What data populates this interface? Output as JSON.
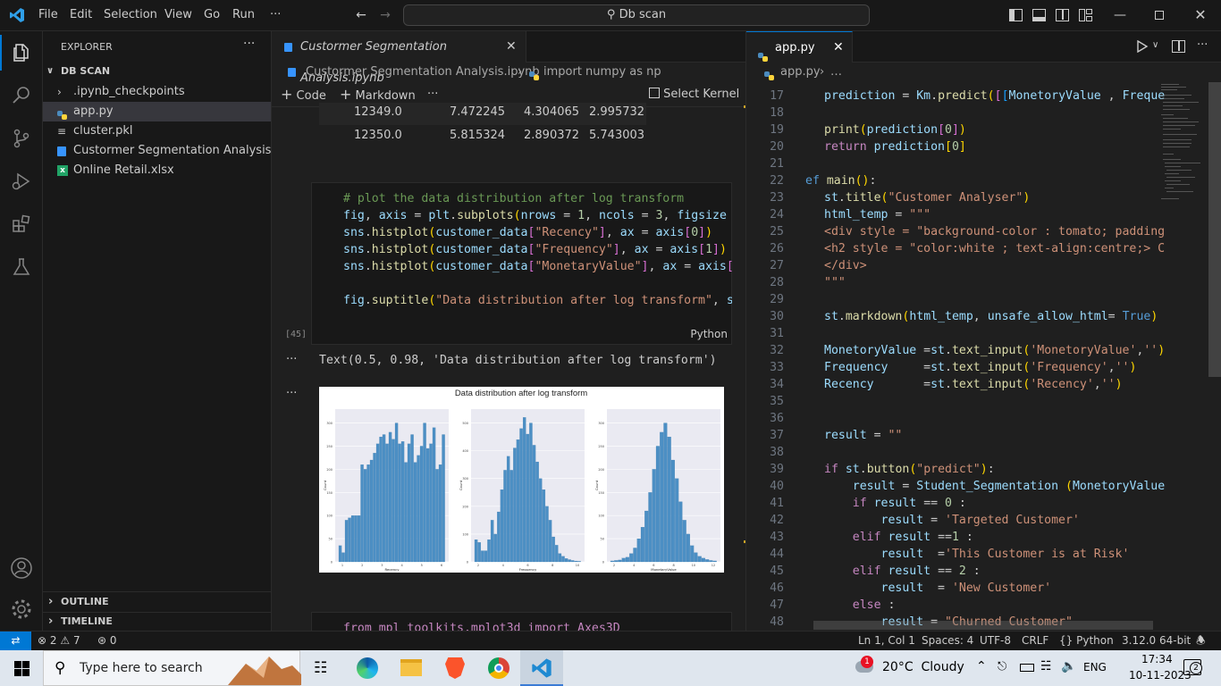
{
  "titlebar": {
    "menu": [
      "File",
      "Edit",
      "Selection",
      "View",
      "Go",
      "Run",
      "···"
    ],
    "search": "Db scan"
  },
  "explorer": {
    "title": "EXPLORER",
    "more": "···",
    "root": "DB SCAN",
    "items": [
      {
        "label": ".ipynb_checkpoints",
        "type": "folder"
      },
      {
        "label": "app.py",
        "type": "python"
      },
      {
        "label": "cluster.pkl",
        "type": "file"
      },
      {
        "label": "Custormer Segmentation Analysis.ip...",
        "type": "notebook"
      },
      {
        "label": "Online Retail.xlsx",
        "type": "excel"
      }
    ],
    "outline": "OUTLINE",
    "timeline": "TIMELINE"
  },
  "notebook": {
    "tab_title": "Custormer Segmentation Analysis.ipynb",
    "breadcrumb": [
      "Custormer Segmentation Analysis.ipynb",
      "import numpy as np"
    ],
    "toolbar": {
      "code": "Code",
      "markdown": "Markdown",
      "more": "···",
      "kernel": "Select Kernel"
    },
    "table_rows": [
      [
        "12349.0",
        "7.472245",
        "4.304065",
        "2.995732"
      ],
      [
        "12350.0",
        "5.815324",
        "2.890372",
        "5.743003"
      ]
    ],
    "cell_exec": "[45]",
    "cell_lang": "Python",
    "output_text": "Text(0.5, 0.98, 'Data distribution after log transform')",
    "next_cell_partial": "from mpl_toolkits.mplot3d import Axes3D"
  },
  "chart_data": {
    "type": "bar",
    "title": "Data distribution after log transform",
    "panels": [
      {
        "xlabel": "Recency",
        "ylabel": "Count",
        "xticks": [
          "1",
          "2",
          "3",
          "4",
          "5",
          "6"
        ],
        "yticks": [
          "0",
          "50",
          "100",
          "150",
          "200",
          "250",
          "300"
        ],
        "ylim": [
          0,
          330
        ],
        "values": [
          35,
          20,
          90,
          95,
          100,
          100,
          100,
          210,
          200,
          210,
          220,
          235,
          255,
          270,
          275,
          255,
          280,
          265,
          300,
          255,
          260,
          215,
          255,
          275,
          215,
          230,
          250,
          300,
          245,
          255,
          290,
          200,
          210,
          275
        ]
      },
      {
        "xlabel": "Frequency",
        "ylabel": "Count",
        "xticks": [
          "2",
          "4",
          "6",
          "8",
          "10"
        ],
        "yticks": [
          "0",
          "100",
          "200",
          "300",
          "400",
          "500"
        ],
        "ylim": [
          0,
          550
        ],
        "values": [
          80,
          70,
          40,
          40,
          80,
          150,
          100,
          180,
          260,
          330,
          380,
          330,
          410,
          440,
          480,
          520,
          460,
          500,
          420,
          360,
          300,
          260,
          200,
          150,
          90,
          60,
          30,
          20,
          12,
          8,
          5,
          3,
          2
        ]
      },
      {
        "xlabel": "MonetaryValue",
        "ylabel": "Count",
        "xticks": [
          "2",
          "4",
          "6",
          "8",
          "10",
          "12"
        ],
        "yticks": [
          "0",
          "50",
          "100",
          "150",
          "200",
          "250",
          "300"
        ],
        "ylim": [
          0,
          330
        ],
        "values": [
          2,
          3,
          4,
          8,
          10,
          18,
          30,
          50,
          75,
          110,
          150,
          200,
          250,
          280,
          300,
          270,
          220,
          180,
          130,
          90,
          60,
          35,
          20,
          12,
          8,
          5,
          3,
          2
        ]
      }
    ]
  },
  "editor": {
    "tab_title": "app.py",
    "breadcrumb": [
      "app.py",
      "…"
    ],
    "lines": [
      17,
      18,
      19,
      20,
      21,
      22,
      23,
      24,
      25,
      26,
      27,
      28,
      29,
      30,
      31,
      32,
      33,
      34,
      35,
      36,
      37,
      38,
      39,
      40,
      41,
      42,
      43,
      44,
      45,
      46,
      47,
      48
    ]
  },
  "status": {
    "problems": "2",
    "warnings": "7",
    "ports": "0",
    "position": "Ln 1, Col 1",
    "spaces": "Spaces: 4",
    "encoding": "UTF-8",
    "eol": "CRLF",
    "language": "Python",
    "interpreter": "3.12.0 64-bit"
  },
  "taskbar": {
    "search": "Type here to search",
    "weather": "20°C  Cloudy",
    "weather_badge": "1",
    "lang": "ENG",
    "time": "17:34",
    "date": "10-11-2023",
    "notifications": "2"
  }
}
